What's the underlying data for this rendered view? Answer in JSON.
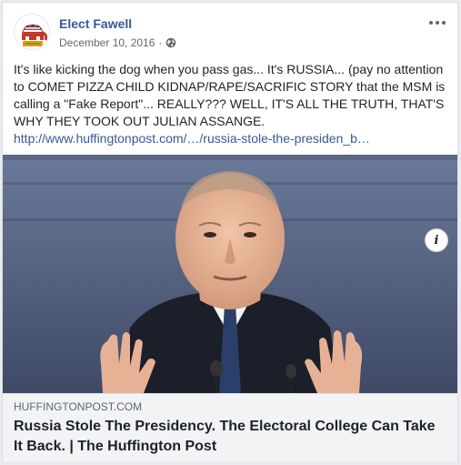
{
  "post": {
    "author": "Elect Fawell",
    "date": "December 10, 2016",
    "separator": "·",
    "privacy_icon": "globe-icon",
    "text": "It's like kicking the dog when you pass gas... It's RUSSIA... (pay no attention to COMET PIZZA CHILD KIDNAP/RAPE/SACRIFIC STORY that the MSM is calling a \"Fake Report\"... REALLY??? WELL, IT'S ALL THE TRUTH, THAT'S WHY THEY TOOK OUT JULIAN ASSANGE.",
    "link_text": "http://www.huffingtonpost.com/…/russia-stole-the-presiden_b…"
  },
  "link_preview": {
    "domain": "HUFFINGTONPOST.COM",
    "headline": "Russia Stole The Presidency. The Electoral College Can Take It Back. | The Huffington Post",
    "info_icon_glyph": "i"
  },
  "colors": {
    "link_blue": "#385898",
    "text": "#1d2129",
    "meta_gray": "#616770",
    "preview_bg": "#f2f3f5"
  }
}
